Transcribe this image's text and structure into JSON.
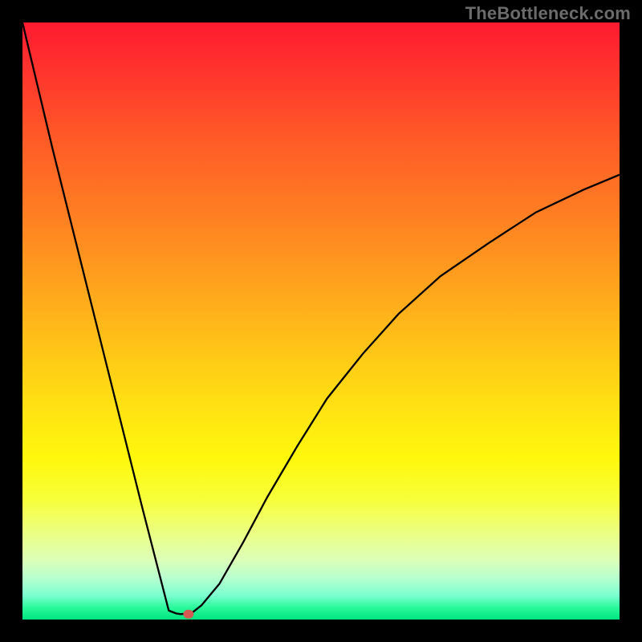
{
  "watermark": "TheBottleneck.com",
  "chart_data": {
    "type": "line",
    "title": "",
    "xlabel": "",
    "ylabel": "",
    "xlim": [
      0,
      1
    ],
    "ylim": [
      0,
      1
    ],
    "grid": false,
    "series": [
      {
        "name": "curve",
        "x": [
          0.0,
          0.05,
          0.1,
          0.15,
          0.2,
          0.245,
          0.258,
          0.265,
          0.275,
          0.285,
          0.3,
          0.33,
          0.37,
          0.41,
          0.46,
          0.51,
          0.57,
          0.63,
          0.7,
          0.78,
          0.86,
          0.94,
          1.0
        ],
        "y": [
          1.0,
          0.79,
          0.59,
          0.39,
          0.19,
          0.015,
          0.01,
          0.009,
          0.01,
          0.012,
          0.024,
          0.06,
          0.13,
          0.205,
          0.29,
          0.37,
          0.445,
          0.512,
          0.575,
          0.63,
          0.682,
          0.72,
          0.745
        ],
        "color": "#000000"
      },
      {
        "name": "bottom-flat",
        "x": [
          0.245,
          0.258
        ],
        "y": [
          0.015,
          0.01
        ],
        "color": "#000000"
      }
    ],
    "marker": {
      "name": "bottleneck-point",
      "x": 0.278,
      "y": 0.009,
      "color": "#d55a53"
    }
  }
}
